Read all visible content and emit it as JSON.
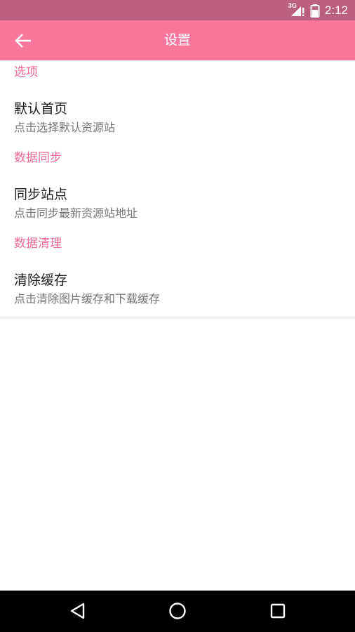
{
  "status_bar": {
    "network": "3G",
    "time": "2:12"
  },
  "app_bar": {
    "title": "设置",
    "back_icon": "arrow-left-icon"
  },
  "sections": [
    {
      "header": "选项",
      "items": [
        {
          "title": "默认首页",
          "summary": "点击选择默认资源站"
        }
      ]
    },
    {
      "header": "数据同步",
      "items": [
        {
          "title": "同步站点",
          "summary": "点击同步最新资源站地址"
        }
      ]
    },
    {
      "header": "数据清理",
      "items": [
        {
          "title": "清除缓存",
          "summary": "点击清除图片缓存和下载缓存"
        }
      ]
    }
  ],
  "nav_bar": {
    "back_icon": "triangle-back-icon",
    "home_icon": "circle-home-icon",
    "recents_icon": "square-recents-icon"
  },
  "colors": {
    "status_bar": "#bb5e7f",
    "app_bar": "#f9779a",
    "accent": "#f06a91",
    "nav_bar": "#000000"
  }
}
